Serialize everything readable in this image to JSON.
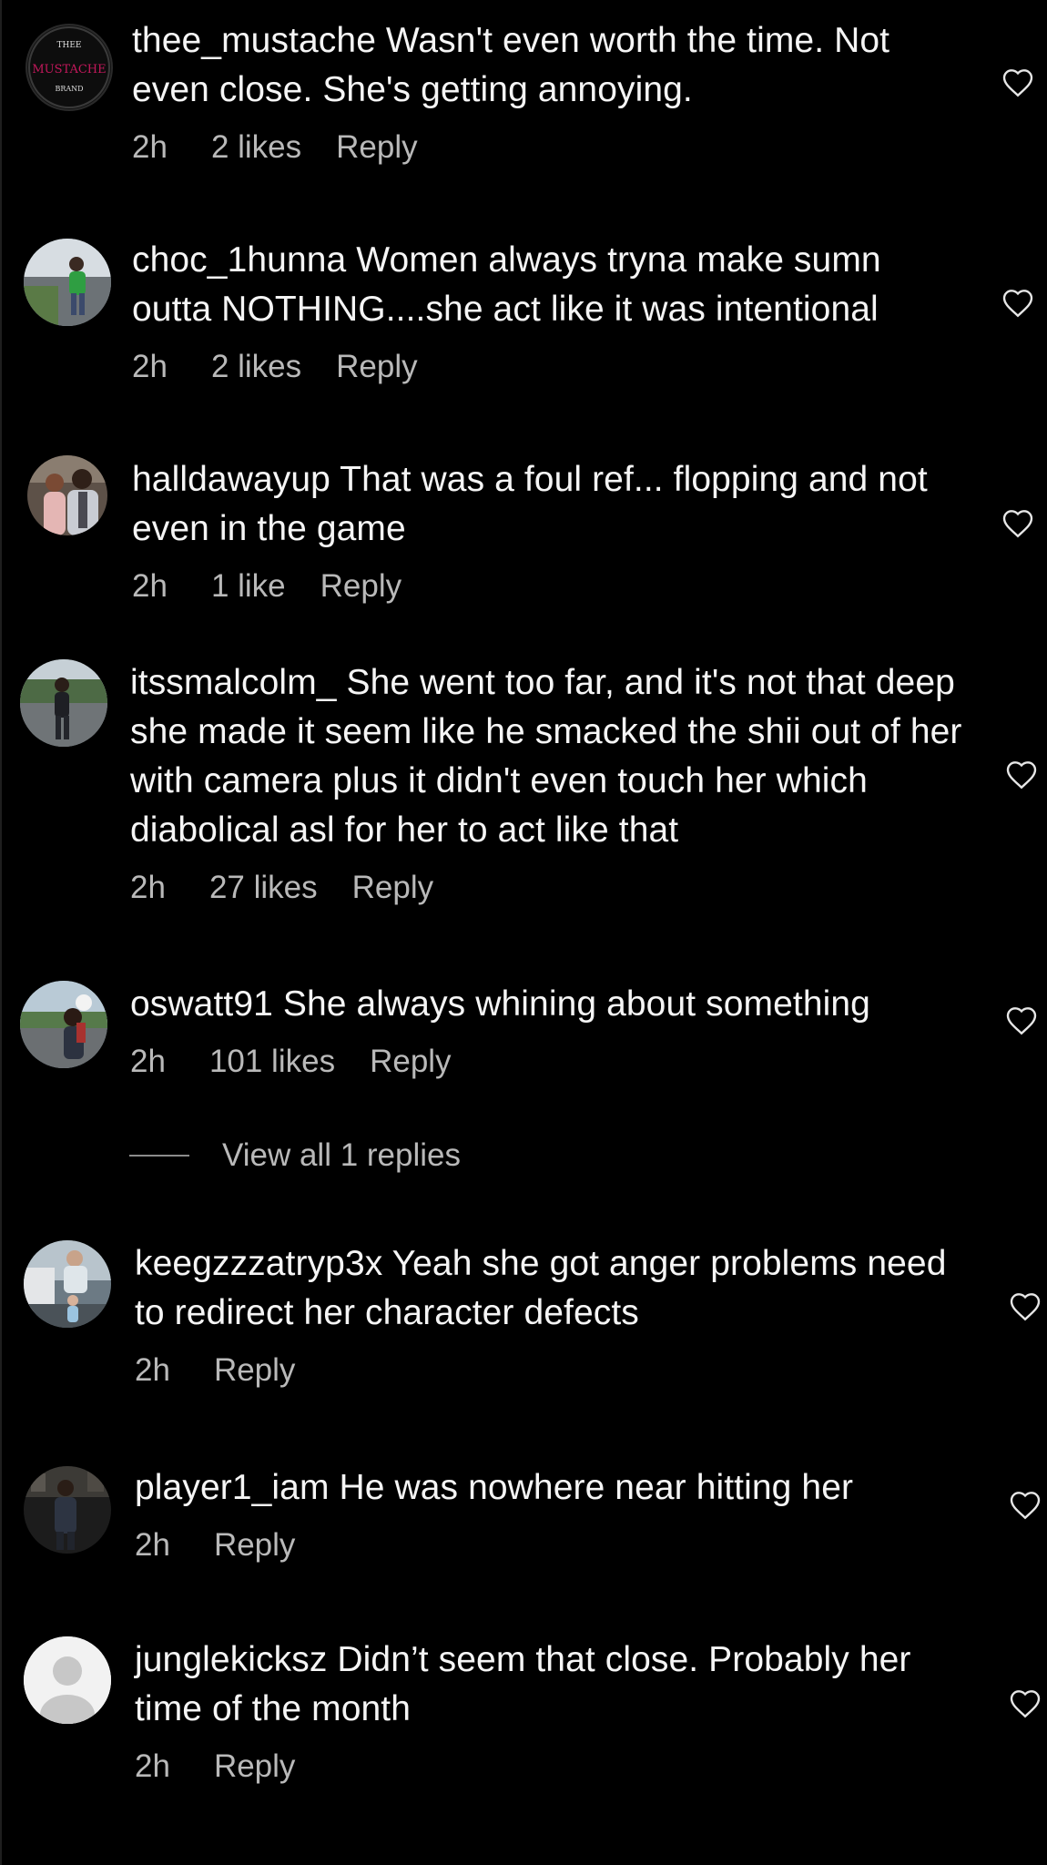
{
  "comments": [
    {
      "username": "thee_mustache",
      "text": "Wasn't even worth the time. Not even close. She's getting annoying.",
      "time": "2h",
      "likes": "2 likes",
      "reply": "Reply",
      "avatar_text": [
        "THEE",
        "MUSTACHE",
        "BRAND"
      ]
    },
    {
      "username": "choc_1hunna",
      "text": "Women always tryna make sumn outta NOTHING....she act like it was intentional",
      "time": "2h",
      "likes": "2 likes",
      "reply": "Reply"
    },
    {
      "username": "halldawayup",
      "text": "That was a foul ref... flopping and not even in the game",
      "time": "2h",
      "likes": "1 like",
      "reply": "Reply"
    },
    {
      "username": "itssmalcolm_",
      "text": "She went too far, and it's not that deep she made it seem like he smacked the shii out of her with camera plus it didn't even touch her which diabolical asl for her to act like that",
      "time": "2h",
      "likes": "27 likes",
      "reply": "Reply"
    },
    {
      "username": "oswatt91",
      "text": "She always whining about something",
      "time": "2h",
      "likes": "101 likes",
      "reply": "Reply"
    },
    {
      "username": "keegzzzatryp3x",
      "text": "Yeah she got anger problems need to redirect her character defects",
      "time": "2h",
      "reply": "Reply"
    },
    {
      "username": "player1_iam",
      "text": "He was nowhere near hitting her",
      "time": "2h",
      "reply": "Reply"
    },
    {
      "username": "junglekicksz",
      "text": "Didn’t seem that close. Probably her time of the month",
      "time": "2h",
      "reply": "Reply"
    }
  ],
  "view_replies": "View all 1 replies",
  "icons": {
    "heart": "heart-outline-icon",
    "default_avatar": "default-avatar-icon"
  },
  "colors": {
    "background": "#000000",
    "text": "#f5f5f5",
    "meta": "#b9b9b9",
    "heart_stroke": "#e6e6e6",
    "avatar_logo_accent": "#c2185b"
  }
}
